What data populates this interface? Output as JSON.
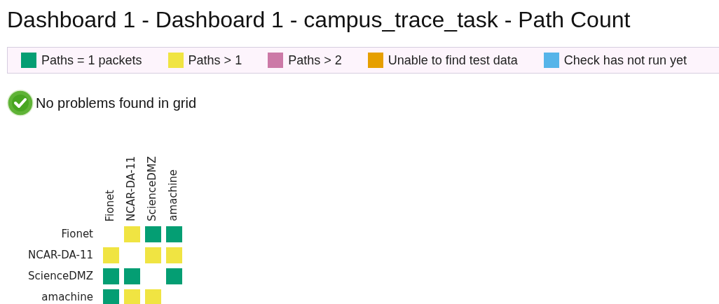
{
  "title": "Dashboard 1 - Dashboard 1 - campus_trace_task - Path Count",
  "legend": [
    {
      "kind": "eq1",
      "label": "Paths = 1 packets",
      "color": "#049e73"
    },
    {
      "kind": "gt1",
      "label": "Paths > 1",
      "color": "#f0e442"
    },
    {
      "kind": "gt2",
      "label": "Paths > 2",
      "color": "#cc79a7"
    },
    {
      "kind": "nodata",
      "label": "Unable to find test data",
      "color": "#e69f00"
    },
    {
      "kind": "notrun",
      "label": "Check has not run yet",
      "color": "#56b4e9"
    }
  ],
  "grid_status": {
    "ok": true,
    "text": "No problems found in grid"
  },
  "grid": {
    "columns": [
      "Fionet",
      "NCAR-DA-11",
      "ScienceDMZ",
      "amachine"
    ],
    "rows": [
      {
        "label": "Fionet",
        "cells": [
          {
            "kind": "none"
          },
          {
            "kind": "gt1"
          },
          {
            "kind": "eq1"
          },
          {
            "kind": "eq1"
          }
        ]
      },
      {
        "label": "NCAR-DA-11",
        "cells": [
          {
            "kind": "gt1"
          },
          {
            "kind": "none"
          },
          {
            "kind": "gt1"
          },
          {
            "kind": "gt1"
          }
        ]
      },
      {
        "label": "ScienceDMZ",
        "cells": [
          {
            "kind": "eq1"
          },
          {
            "kind": "eq1"
          },
          {
            "kind": "none"
          },
          {
            "kind": "eq1"
          }
        ]
      },
      {
        "label": "amachine",
        "cells": [
          {
            "kind": "eq1"
          },
          {
            "kind": "gt1"
          },
          {
            "kind": "gt1"
          },
          {
            "kind": "none"
          }
        ]
      }
    ]
  }
}
